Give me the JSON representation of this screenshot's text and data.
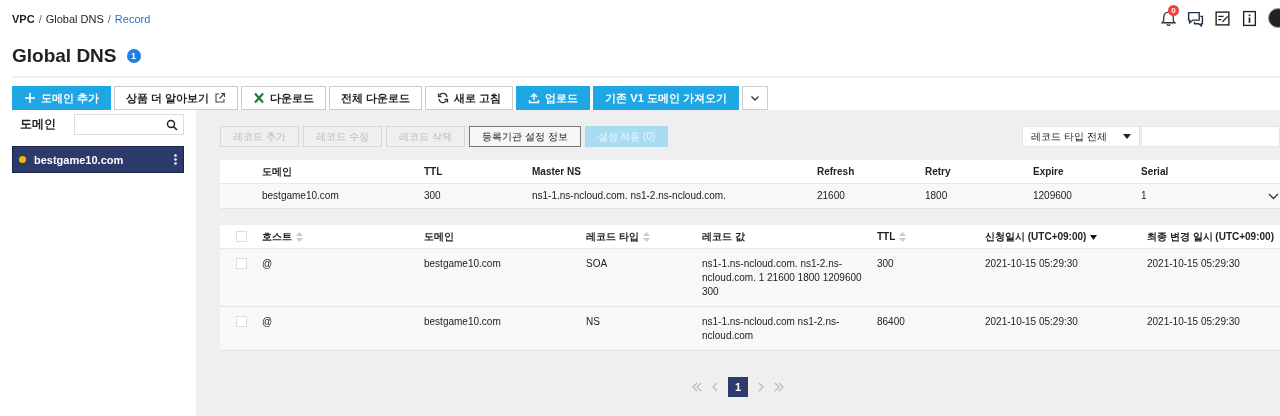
{
  "breadcrumb": [
    {
      "label": "VPC",
      "current": false,
      "separator": "/"
    },
    {
      "label": "Global DNS",
      "current": false,
      "separator": "/"
    },
    {
      "label": "Record",
      "current": true
    }
  ],
  "notification_count": "0",
  "title": "Global DNS",
  "title_badge": "1",
  "toolbar": [
    {
      "label": "도메인 추가",
      "kind": "add",
      "primary": true
    },
    {
      "label": "상품 더 알아보기",
      "kind": "external",
      "primary": false
    },
    {
      "label": "다운로드",
      "kind": "excel",
      "primary": false
    },
    {
      "label": "전체 다운로드",
      "kind": "plain",
      "primary": false
    },
    {
      "label": "새로 고침",
      "kind": "refresh",
      "primary": false
    },
    {
      "label": "업로드",
      "kind": "upload",
      "primary": true
    },
    {
      "label": "기존 V1 도메인 가져오기",
      "kind": "plain",
      "primary": true
    }
  ],
  "sidebar": {
    "label": "도메인",
    "domains": [
      {
        "name": "bestgame10.com",
        "selected": true,
        "color": "#f5b800"
      }
    ]
  },
  "record_actions": [
    {
      "label": "레코드 추가",
      "kind": "plain",
      "disabled": true
    },
    {
      "label": "레코드 수정",
      "kind": "plain",
      "disabled": true
    },
    {
      "label": "레코드 삭제",
      "kind": "plain",
      "disabled": true
    },
    {
      "label": "등록기관 설정 정보",
      "kind": "outline",
      "disabled": false
    },
    {
      "label": "설정 적용 (0)",
      "kind": "primary",
      "disabled": true
    }
  ],
  "record_type_filter": "레코드 타입 전체",
  "domain_table": {
    "columns": [
      "도메인",
      "TTL",
      "Master NS",
      "Refresh",
      "Retry",
      "Expire",
      "Serial"
    ],
    "rows": [
      {
        "expanded": false,
        "cells": [
          "bestgame10.com",
          "300",
          "ns1-1.ns-ncloud.com. ns1-2.ns-ncloud.com.",
          "21600",
          "1800",
          "1209600",
          "1"
        ]
      }
    ]
  },
  "record_table": {
    "columns": [
      {
        "label": "호스트",
        "sortable": true,
        "sorted": false
      },
      {
        "label": "도메인",
        "sortable": false
      },
      {
        "label": "레코드 타입",
        "sortable": true,
        "sorted": false
      },
      {
        "label": "레코드 값",
        "sortable": false
      },
      {
        "label": "TTL",
        "sortable": true,
        "sorted": false
      },
      {
        "label": "신청일시 (UTC+09:00)",
        "sortable": true,
        "sorted": true
      },
      {
        "label": "최종 변경 일시 (UTC+09:00)",
        "sortable": false
      }
    ],
    "all_checked": false,
    "rows": [
      {
        "checked": false,
        "cells": [
          "@",
          "bestgame10.com",
          "SOA",
          "ns1-1.ns-ncloud.com. ns1-2.ns-ncloud.com. 1 21600 1800 1209600 300",
          "300",
          "2021-10-15 05:29:30",
          "2021-10-15 05:29:30"
        ]
      },
      {
        "checked": false,
        "cells": [
          "@",
          "bestgame10.com",
          "NS",
          "ns1-1.ns-ncloud.com ns1-2.ns-ncloud.com",
          "86400",
          "2021-10-15 05:29:30",
          "2021-10-15 05:29:30"
        ]
      }
    ]
  },
  "pagination": {
    "pages": [
      {
        "label": "1",
        "selected": true
      }
    ]
  }
}
